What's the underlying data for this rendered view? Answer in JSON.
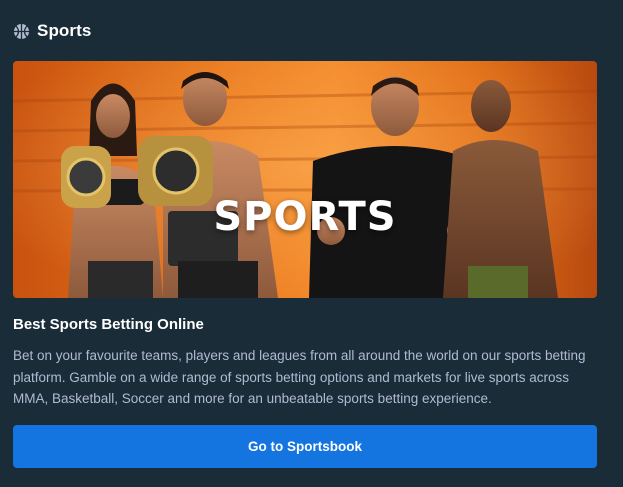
{
  "section": {
    "title": "Sports",
    "icon": "basketball-icon"
  },
  "banner": {
    "text": "SPORTS",
    "accent": "#f3892a"
  },
  "content": {
    "heading": "Best Sports Betting Online",
    "description": "Bet on your favourite teams, players and leagues from all around the world on our sports betting platform. Gamble on a wide range of sports betting options and markets for live sports across MMA, Basketball, Soccer and more for an unbeatable sports betting experience."
  },
  "cta": {
    "label": "Go to Sportsbook",
    "color": "#1475e1"
  }
}
